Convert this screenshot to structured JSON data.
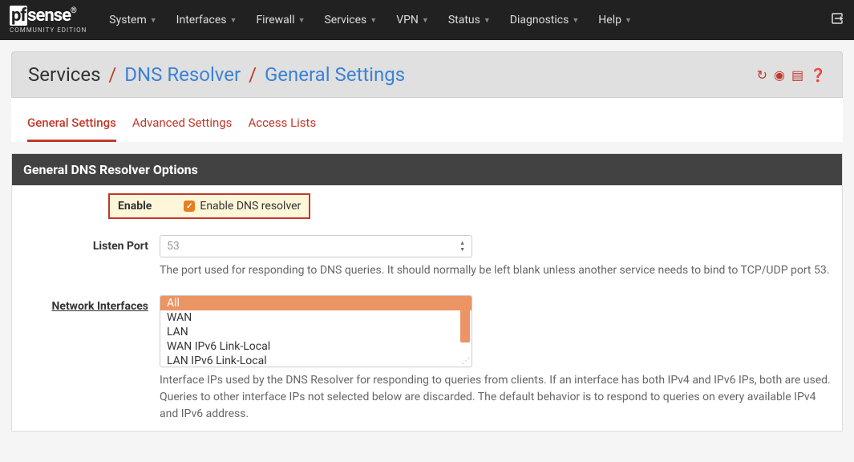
{
  "brand": {
    "logo_pf": "pf",
    "logo_sense": "sense",
    "sub": "COMMUNITY EDITION"
  },
  "nav": {
    "items": [
      "System",
      "Interfaces",
      "Firewall",
      "Services",
      "VPN",
      "Status",
      "Diagnostics",
      "Help"
    ]
  },
  "breadcrumb": {
    "root": "Services",
    "mid": "DNS Resolver",
    "leaf": "General Settings"
  },
  "tabs": {
    "t0": "General Settings",
    "t1": "Advanced Settings",
    "t2": "Access Lists"
  },
  "panel": {
    "heading": "General DNS Resolver Options"
  },
  "enable": {
    "label": "Enable",
    "checkbox_label": "Enable DNS resolver"
  },
  "listen_port": {
    "label": "Listen Port",
    "placeholder": "53",
    "help": "The port used for responding to DNS queries. It should normally be left blank unless another service needs to bind to TCP/UDP port 53."
  },
  "network_interfaces": {
    "label": "Network Interfaces",
    "options": {
      "o0": "All",
      "o1": "WAN",
      "o2": "LAN",
      "o3": "WAN IPv6 Link-Local",
      "o4": "LAN IPv6 Link-Local"
    },
    "help": "Interface IPs used by the DNS Resolver for responding to queries from clients. If an interface has both IPv4 and IPv6 IPs, both are used. Queries to other interface IPs not selected below are discarded. The default behavior is to respond to queries on every available IPv4 and IPv6 address."
  }
}
